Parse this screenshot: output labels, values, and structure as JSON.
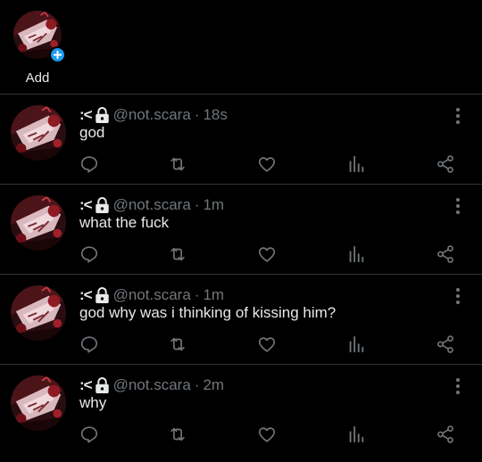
{
  "fleets": {
    "add_label": "Add"
  },
  "colors": {
    "background": "#000000",
    "divider": "#2f3336",
    "text": "#e7e9ea",
    "secondary": "#71767b",
    "accent": "#1d9bf0"
  },
  "icons": {
    "more": "more-vertical-icon",
    "reply": "reply-icon",
    "retweet": "retweet-icon",
    "like": "heart-icon",
    "views": "views-bar-chart-icon",
    "share": "share-icon",
    "lock": "lock-icon"
  },
  "tweets": [
    {
      "name": ":<",
      "handle": "@not.scara",
      "separator": "·",
      "time": "18s",
      "text": "god"
    },
    {
      "name": ":<",
      "handle": "@not.scara",
      "separator": "·",
      "time": "1m",
      "text": "what the fuck"
    },
    {
      "name": ":<",
      "handle": "@not.scara",
      "separator": "·",
      "time": "1m",
      "text": "god why was i thinking of kissing him?"
    },
    {
      "name": ":<",
      "handle": "@not.scara",
      "separator": "·",
      "time": "2m",
      "text": "why"
    }
  ]
}
